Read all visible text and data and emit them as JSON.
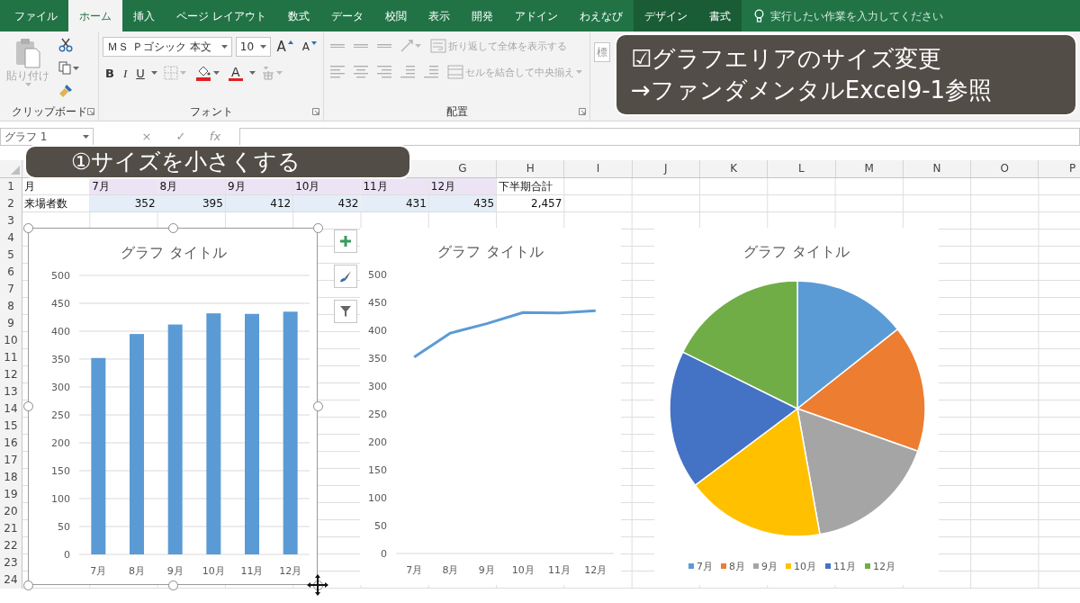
{
  "tabs": [
    {
      "label": "ファイル",
      "selected": false,
      "contextual": false
    },
    {
      "label": "ホーム",
      "selected": true,
      "contextual": false
    },
    {
      "label": "挿入",
      "selected": false,
      "contextual": false
    },
    {
      "label": "ページ レイアウト",
      "selected": false,
      "contextual": false
    },
    {
      "label": "数式",
      "selected": false,
      "contextual": false
    },
    {
      "label": "データ",
      "selected": false,
      "contextual": false
    },
    {
      "label": "校閲",
      "selected": false,
      "contextual": false
    },
    {
      "label": "表示",
      "selected": false,
      "contextual": false
    },
    {
      "label": "開発",
      "selected": false,
      "contextual": false
    },
    {
      "label": "アドイン",
      "selected": false,
      "contextual": false
    },
    {
      "label": "わえなび",
      "selected": false,
      "contextual": false
    },
    {
      "label": "デザイン",
      "selected": false,
      "contextual": true
    },
    {
      "label": "書式",
      "selected": false,
      "contextual": true
    }
  ],
  "tell_me": {
    "placeholder": "実行したい作業を入力してください"
  },
  "ribbon": {
    "clipboard": {
      "paste_label": "貼り付け",
      "paste_disabled": true,
      "group_label": "クリップボード"
    },
    "font": {
      "font_name": "ＭＳ Ｐゴシック 本文",
      "font_size": "10",
      "grow": "A",
      "shrink": "A",
      "bold": "B",
      "italic": "I",
      "underline": "U",
      "font_color": "A",
      "group_label": "フォント"
    },
    "alignment": {
      "wrap_label": "折り返して全体を表示する",
      "merge_label": "セルを結合して中央揃え",
      "disabled": true,
      "group_label": "配置"
    },
    "number": {
      "format": "標"
    }
  },
  "formula_bar": {
    "name_box": "グラフ 1",
    "buttons": [
      "×",
      "✓",
      "fx"
    ]
  },
  "callouts": [
    {
      "kind": "banner",
      "lines": [
        "☑グラフエリアのサイズ変更",
        "→ファンダメンタルExcel9-1参照"
      ]
    },
    {
      "kind": "step",
      "lines": [
        "①サイズを小さくする"
      ]
    }
  ],
  "sheet": {
    "column_headers": [
      "G",
      "H",
      "I",
      "J",
      "K",
      "L",
      "M",
      "N",
      "O",
      "P"
    ],
    "row_headers": [
      "1",
      "2",
      "3",
      "4",
      "5",
      "6",
      "7",
      "8",
      "9",
      "10",
      "11",
      "12",
      "13",
      "14",
      "15",
      "16",
      "17",
      "18",
      "19",
      "20",
      "21",
      "22",
      "23",
      "24"
    ],
    "cells": [
      [
        {
          "text": "月",
          "kind": "text"
        },
        {
          "text": "7月",
          "kind": "text",
          "color": "#ece4f4"
        },
        {
          "text": "8月",
          "kind": "text",
          "color": "#ece4f4"
        },
        {
          "text": "9月",
          "kind": "text",
          "color": "#ece4f4"
        },
        {
          "text": "10月",
          "kind": "text",
          "color": "#ece4f4"
        },
        {
          "text": "11月",
          "kind": "text",
          "color": "#ece4f4"
        },
        {
          "text": "12月",
          "kind": "text",
          "color": "#ece4f4"
        },
        {
          "text": "下半期合計",
          "kind": "text"
        }
      ],
      [
        {
          "text": "来場者数",
          "kind": "text"
        },
        {
          "text": "352",
          "kind": "number",
          "color": "#e4edf8"
        },
        {
          "text": "395",
          "kind": "number",
          "color": "#e4edf8"
        },
        {
          "text": "412",
          "kind": "number",
          "color": "#e4edf8"
        },
        {
          "text": "432",
          "kind": "number",
          "color": "#e4edf8"
        },
        {
          "text": "431",
          "kind": "number",
          "color": "#e4edf8"
        },
        {
          "text": "435",
          "kind": "number",
          "color": "#e4edf8"
        },
        {
          "text": "2,457",
          "kind": "number"
        }
      ]
    ]
  },
  "charts": [
    {
      "selected": true,
      "chart_data": {
        "type": "bar",
        "title": "グラフ タイトル",
        "categories": [
          "7月",
          "8月",
          "9月",
          "10月",
          "11月",
          "12月"
        ],
        "values": [
          352,
          395,
          412,
          432,
          431,
          435
        ],
        "ylim": [
          0,
          500
        ],
        "yticks": [
          0,
          50,
          100,
          150,
          200,
          250,
          300,
          350,
          400,
          450,
          500
        ],
        "grid": true
      }
    },
    {
      "selected": false,
      "chart_data": {
        "type": "line",
        "title": "グラフ タイトル",
        "categories": [
          "7月",
          "8月",
          "9月",
          "10月",
          "11月",
          "12月"
        ],
        "values": [
          352,
          395,
          412,
          432,
          431,
          435
        ],
        "ylim": [
          0,
          500
        ],
        "yticks": [
          0,
          50,
          100,
          150,
          200,
          250,
          300,
          350,
          400,
          450,
          500
        ]
      }
    },
    {
      "selected": false,
      "chart_data": {
        "type": "pie",
        "title": "グラフ タイトル",
        "categories": [
          "7月",
          "8月",
          "9月",
          "10月",
          "11月",
          "12月"
        ],
        "series": [
          {
            "values": [
              14.33,
              16.08,
              16.77,
              17.58,
              17.54,
              17.7
            ]
          }
        ],
        "colors": [
          "#5b9bd5",
          "#ed7d31",
          "#a5a5a5",
          "#ffc000",
          "#4472c4",
          "#70ad47"
        ],
        "legend": "bottom"
      }
    }
  ]
}
